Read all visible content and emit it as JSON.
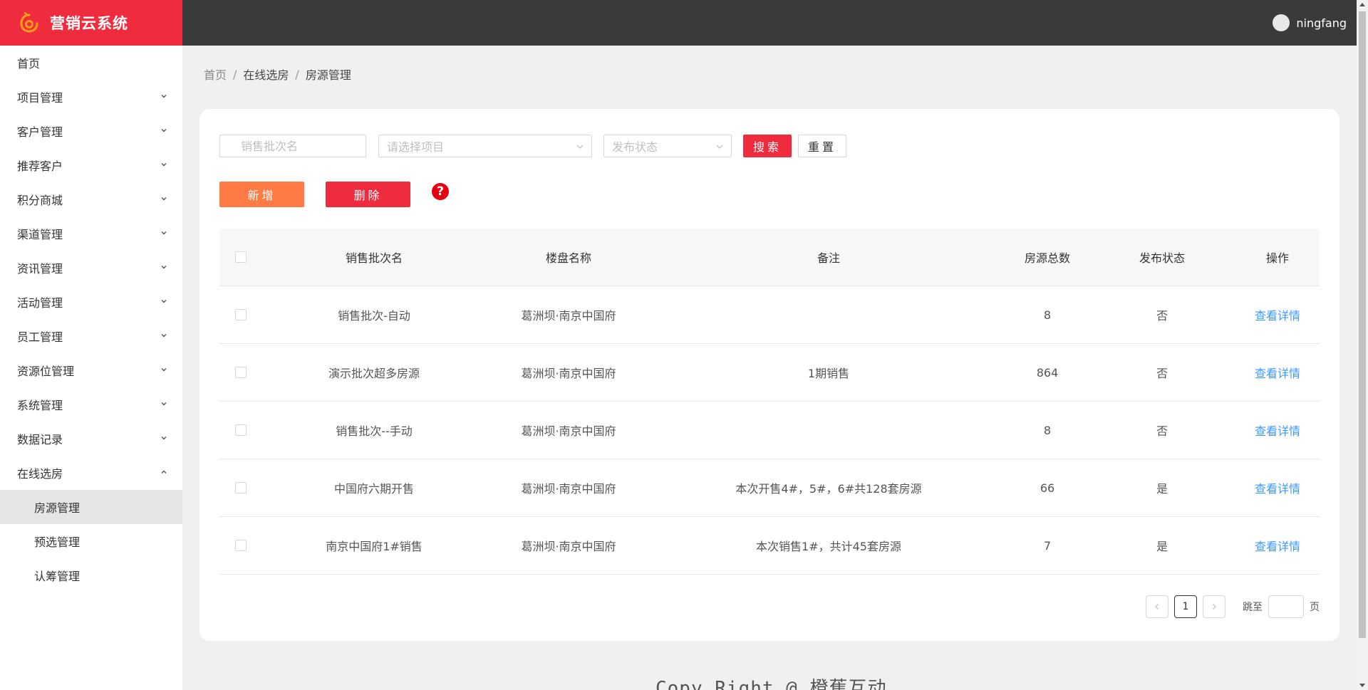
{
  "app": {
    "title": "营销云系统",
    "user": "ningfang"
  },
  "sidebar": {
    "items": [
      {
        "label": "首页",
        "has_arrow": false
      },
      {
        "label": "项目管理",
        "has_arrow": true
      },
      {
        "label": "客户管理",
        "has_arrow": true
      },
      {
        "label": "推荐客户",
        "has_arrow": true
      },
      {
        "label": "积分商城",
        "has_arrow": true
      },
      {
        "label": "渠道管理",
        "has_arrow": true
      },
      {
        "label": "资讯管理",
        "has_arrow": true
      },
      {
        "label": "活动管理",
        "has_arrow": true
      },
      {
        "label": "员工管理",
        "has_arrow": true
      },
      {
        "label": "资源位管理",
        "has_arrow": true
      },
      {
        "label": "系统管理",
        "has_arrow": true
      },
      {
        "label": "数据记录",
        "has_arrow": true
      },
      {
        "label": "在线选房",
        "has_arrow": true,
        "expanded": true
      }
    ],
    "subitems": [
      {
        "label": "房源管理",
        "active": true
      },
      {
        "label": "预选管理",
        "active": false
      },
      {
        "label": "认筹管理",
        "active": false
      }
    ]
  },
  "breadcrumb": [
    "首页",
    "在线选房",
    "房源管理"
  ],
  "filters": {
    "batch_placeholder": "销售批次名",
    "project_placeholder": "请选择项目",
    "status_placeholder": "发布状态",
    "search_label": "搜索",
    "reset_label": "重置"
  },
  "actions": {
    "add_label": "新增",
    "delete_label": "删除",
    "help_label": "?"
  },
  "table": {
    "headers": [
      "销售批次名",
      "楼盘名称",
      "备注",
      "房源总数",
      "发布状态",
      "操作"
    ],
    "rows": [
      {
        "batch": "销售批次-自动",
        "estate": "葛洲坝·南京中国府",
        "note": "",
        "total": "8",
        "status": "否",
        "action": "查看详情"
      },
      {
        "batch": "演示批次超多房源",
        "estate": "葛洲坝·南京中国府",
        "note": "1期销售",
        "total": "864",
        "status": "否",
        "action": "查看详情"
      },
      {
        "batch": "销售批次--手动",
        "estate": "葛洲坝·南京中国府",
        "note": "",
        "total": "8",
        "status": "否",
        "action": "查看详情"
      },
      {
        "batch": "中国府六期开售",
        "estate": "葛洲坝·南京中国府",
        "note": "本次开售4#，5#，6#共128套房源",
        "total": "66",
        "status": "是",
        "action": "查看详情"
      },
      {
        "batch": "南京中国府1#销售",
        "estate": "葛洲坝·南京中国府",
        "note": "本次销售1#，共计45套房源",
        "total": "7",
        "status": "是",
        "action": "查看详情"
      }
    ]
  },
  "pagination": {
    "current": "1",
    "jump_label": "跳至",
    "page_label": "页"
  },
  "footer": "Copy Right @ 橙蕉互动",
  "colors": {
    "brand": "#ef2b3e",
    "header": "#393a39",
    "link": "#3b99fc",
    "add": "#ff7a45"
  }
}
